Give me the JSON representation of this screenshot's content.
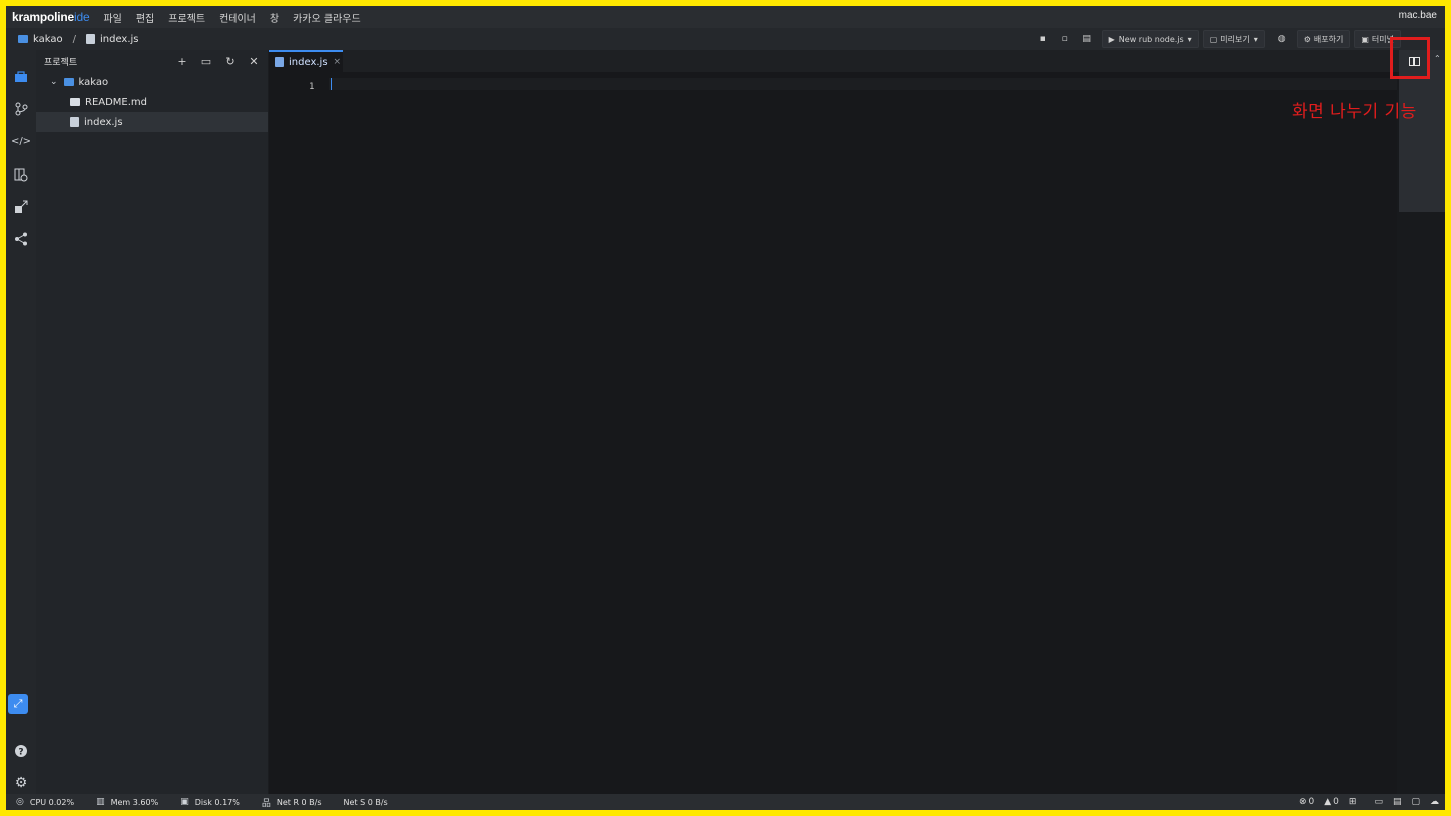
{
  "app": {
    "logo_main": "krampoline",
    "logo_accent": "ide",
    "user": "mac.bae"
  },
  "menu": [
    "파일",
    "편집",
    "프로젝트",
    "컨테이너",
    "창",
    "카카오 클라우드"
  ],
  "breadcrumb": {
    "project": "kakao",
    "separator": "/",
    "file": "index.js"
  },
  "toolbar": {
    "run_label": "New rub node.js",
    "preview_label": "미리보기",
    "deploy_label": "배포하기",
    "extra_label": "터미널"
  },
  "sidebar": {
    "title": "프로젝트",
    "tree": {
      "folder": "kakao",
      "files": [
        "README.md",
        "index.js"
      ]
    }
  },
  "editor": {
    "tab_label": "index.js",
    "tab_close": "×",
    "line_number": "1"
  },
  "annotation": {
    "text": "화면 나누기 기능",
    "color": "#e11d1d"
  },
  "status": {
    "cpu": "CPU 0.02%",
    "mem": "Mem 3.60%",
    "disk": "Disk 0.17%",
    "net_r": "Net R 0 B/s",
    "net_s": "Net S 0 B/s",
    "errors": "0",
    "warnings": "0"
  },
  "colors": {
    "accent": "#3d8cf0",
    "frame": "#ffe800"
  }
}
